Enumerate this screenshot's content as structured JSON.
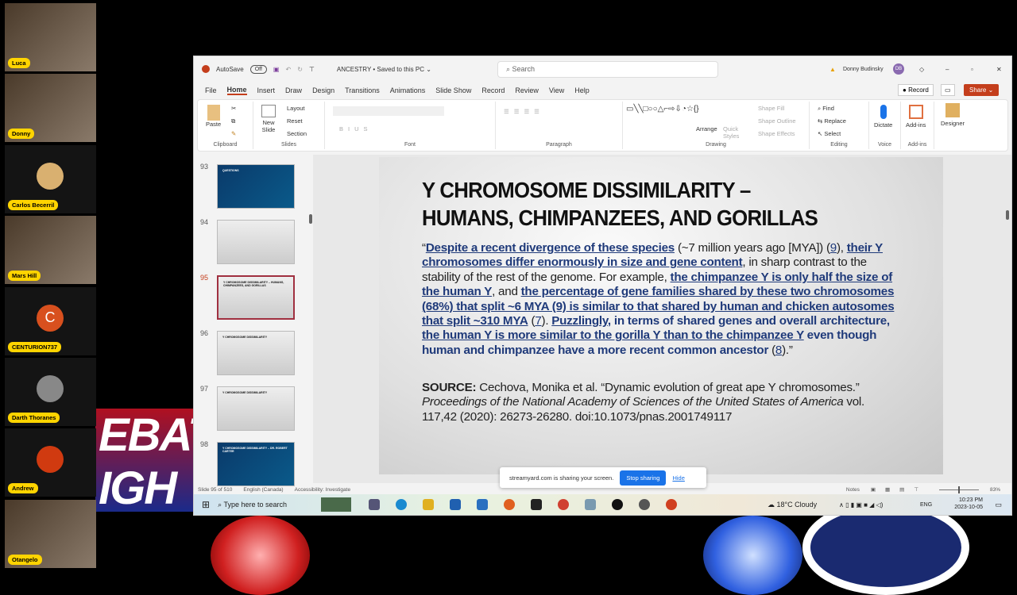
{
  "participants": [
    {
      "name": "Luca",
      "type": "video"
    },
    {
      "name": "Donny",
      "type": "video"
    },
    {
      "name": "Carlos Becerril",
      "type": "avatar",
      "color": "#d9b070"
    },
    {
      "name": "Mars Hill",
      "type": "video"
    },
    {
      "name": "CENTURION737",
      "type": "initial",
      "initial": "C",
      "color": "#d8501e"
    },
    {
      "name": "Darth Thoranes",
      "type": "avatar",
      "color": "#888888"
    },
    {
      "name": "Andrew",
      "type": "avatar",
      "color": "#d03a10"
    },
    {
      "name": "Otangelo",
      "type": "video"
    }
  ],
  "background_banner": "EBAT IGH",
  "titlebar": {
    "autosave": "AutoSave",
    "toggle": "Off",
    "doc": "ANCESTRY • Saved to this PC ⌄",
    "search_placeholder": "Search",
    "user": "Donny Budinsky",
    "user_initials": "DB"
  },
  "tabs": [
    "File",
    "Home",
    "Insert",
    "Draw",
    "Design",
    "Transitions",
    "Animations",
    "Slide Show",
    "Record",
    "Review",
    "View",
    "Help"
  ],
  "ribbon_right": {
    "record": "Record",
    "share": "Share"
  },
  "ribbon": {
    "groups": [
      "Clipboard",
      "Slides",
      "Font",
      "Paragraph",
      "Drawing",
      "Editing",
      "Voice",
      "Add-ins"
    ],
    "paste": "Paste",
    "new_slide": "New Slide",
    "layout": "Layout",
    "reset": "Reset",
    "section": "Section",
    "arrange": "Arrange",
    "quick_styles": "Quick Styles",
    "shape_fill": "Shape Fill",
    "shape_outline": "Shape Outline",
    "shape_effects": "Shape Effects",
    "find": "Find",
    "replace": "Replace",
    "select": "Select",
    "dictate": "Dictate",
    "addins": "Add-ins",
    "designer": "Designer"
  },
  "thumbnails": [
    {
      "num": "93",
      "title": "QUESTIONS",
      "theme": "dark"
    },
    {
      "num": "94",
      "title": "",
      "theme": "light"
    },
    {
      "num": "95",
      "title": "Y CHROMOSOME DISSIMILARITY – HUMANS, CHIMPANZEES, AND GORILLAS",
      "theme": "light",
      "selected": true
    },
    {
      "num": "96",
      "title": "Y CHROMOSOME DISSIMILARITY",
      "theme": "light"
    },
    {
      "num": "97",
      "title": "Y CHROMOSOME DISSIMILARITY",
      "theme": "light"
    },
    {
      "num": "98",
      "title": "Y CHROMOSOME DISSIMILARITY – DR. ROBERT CARTER",
      "theme": "dark"
    }
  ],
  "slide": {
    "title_line1": "Y CHROMOSOME DISSIMILARITY –",
    "title_line2": "HUMANS, CHIMPANZEES, AND GORILLAS",
    "runs": [
      {
        "t": "“",
        "s": ""
      },
      {
        "t": "Despite a recent divergence of these species",
        "s": "ub"
      },
      {
        "t": " (~7 million years ago [MYA]) (",
        "s": ""
      },
      {
        "t": "9",
        "s": "ln"
      },
      {
        "t": "), ",
        "s": ""
      },
      {
        "t": "their Y chromosomes differ enormously in size and gene content",
        "s": "ub"
      },
      {
        "t": ", in sharp contrast to the stability of the rest of the genome. For example, ",
        "s": ""
      },
      {
        "t": "the chimpanzee Y is only half the size of the human Y",
        "s": "ub"
      },
      {
        "t": ", and ",
        "s": ""
      },
      {
        "t": "the percentage of gene families shared by these two chromosomes (68%) that split ~6 MYA (9) is similar to that shared by human and chicken autosomes that split ~310 MYA",
        "s": "ub"
      },
      {
        "t": " (",
        "s": ""
      },
      {
        "t": "7",
        "s": "ln"
      },
      {
        "t": "). ",
        "s": ""
      },
      {
        "t": "Puzzlingly",
        "s": "ub"
      },
      {
        "t": ", in terms of shared genes and overall architecture, ",
        "s": "bb"
      },
      {
        "t": "the human Y is more similar to the gorilla Y than to the chimpanzee Y",
        "s": "ub"
      },
      {
        "t": " even though human and chimpanzee have a more recent common ancestor",
        "s": "bb"
      },
      {
        "t": " (",
        "s": ""
      },
      {
        "t": "8",
        "s": "ln"
      },
      {
        "t": ").”",
        "s": ""
      }
    ],
    "source_label": "SOURCE:",
    "source_authors": " Cechova, Monika et al. “Dynamic evolution of great ape Y chromosomes.” ",
    "source_journal": "Proceedings of the National Academy of Sciences of the United States of America",
    "source_rest": " vol. 117,42 (2020): 26273-26280. doi:10.1073/pnas.2001749117"
  },
  "share_bar": {
    "message": "streamyard.com is sharing your screen.",
    "stop": "Stop sharing",
    "hide": "Hide"
  },
  "status": {
    "slide": "Slide 95 of 510",
    "language": "English (Canada)",
    "accessibility": "Accessibility: Investigate",
    "notes": "Notes",
    "zoom": "83%"
  },
  "taskbar": {
    "search_placeholder": "Type here to search",
    "weather": "18°C Cloudy",
    "lang": "ENG",
    "time": "10:23 PM",
    "date": "2023-10-05"
  }
}
